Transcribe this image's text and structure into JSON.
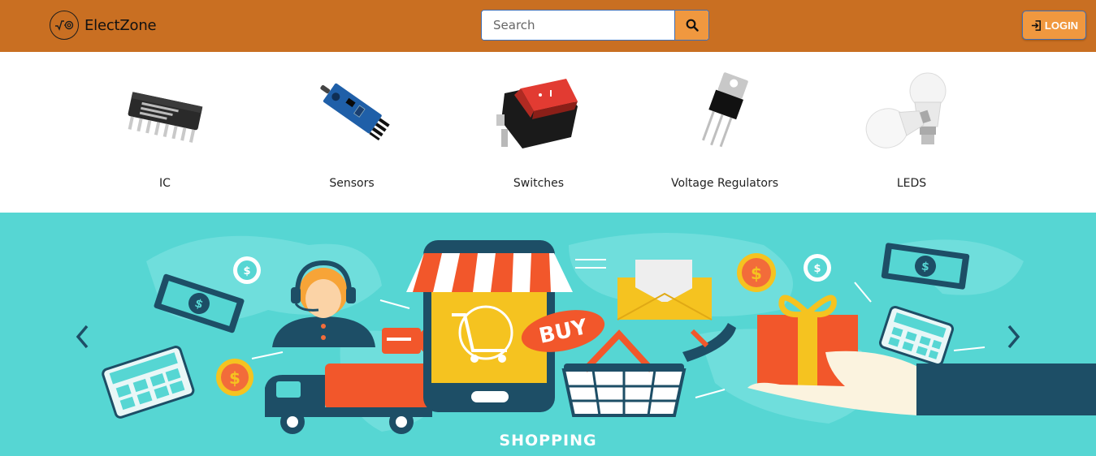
{
  "brand": {
    "name": "ElectZone",
    "logo_icon": "sqrt-wave-logo-icon"
  },
  "search": {
    "placeholder": "Search",
    "value": "",
    "button_icon": "search-icon"
  },
  "auth": {
    "login_label": "LOGIN",
    "login_icon": "login-arrow-icon"
  },
  "categories": [
    {
      "label": "IC",
      "icon": "ic-chip-image"
    },
    {
      "label": "Sensors",
      "icon": "sensor-module-image"
    },
    {
      "label": "Switches",
      "icon": "rocker-switch-image"
    },
    {
      "label": "Voltage Regulators",
      "icon": "voltage-regulator-image"
    },
    {
      "label": "LEDS",
      "icon": "led-bulb-image"
    }
  ],
  "carousel": {
    "slide_banner_text": "BUY",
    "caption": "SHOPPING",
    "prev_icon": "chevron-left-icon",
    "next_icon": "chevron-right-icon"
  },
  "colors": {
    "navbar": "#c96f22",
    "accent": "#f0983f",
    "banner_bg": "#56d6d3",
    "outline_blue": "#3f6fb5"
  }
}
